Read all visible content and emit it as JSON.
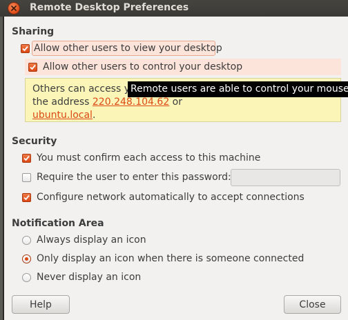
{
  "window": {
    "title": "Remote Desktop Preferences"
  },
  "sharing": {
    "heading": "Sharing",
    "allow_view": {
      "label": "Allow other users to view your desktop",
      "checked": true
    },
    "allow_control": {
      "label": "Allow other users to control your desktop",
      "checked": true
    },
    "info": {
      "line1": "Others can access yo",
      "line2_prefix": "the address ",
      "address": "220.248.104.62",
      "line2_suffix": " or",
      "hostname": "ubuntu.local",
      "line3_suffix": "."
    },
    "tooltip": "Remote users are able to control your mouse and keyboard."
  },
  "security": {
    "heading": "Security",
    "confirm": {
      "label": "You must confirm each access to this machine",
      "checked": true
    },
    "password": {
      "label": "Require the user to enter this password:",
      "checked": false,
      "value": ""
    },
    "network": {
      "label": "Configure network automatically to accept connections",
      "checked": true
    }
  },
  "notification": {
    "heading": "Notification Area",
    "options": [
      {
        "label": "Always display an icon",
        "selected": false
      },
      {
        "label": "Only display an icon when there is someone connected",
        "selected": true
      },
      {
        "label": "Never display an icon",
        "selected": false
      }
    ]
  },
  "buttons": {
    "help": "Help",
    "close": "Close"
  },
  "colors": {
    "accent": "#dd4814",
    "info_bg": "#fbf6b8",
    "tooltip_bg": "#000000"
  }
}
